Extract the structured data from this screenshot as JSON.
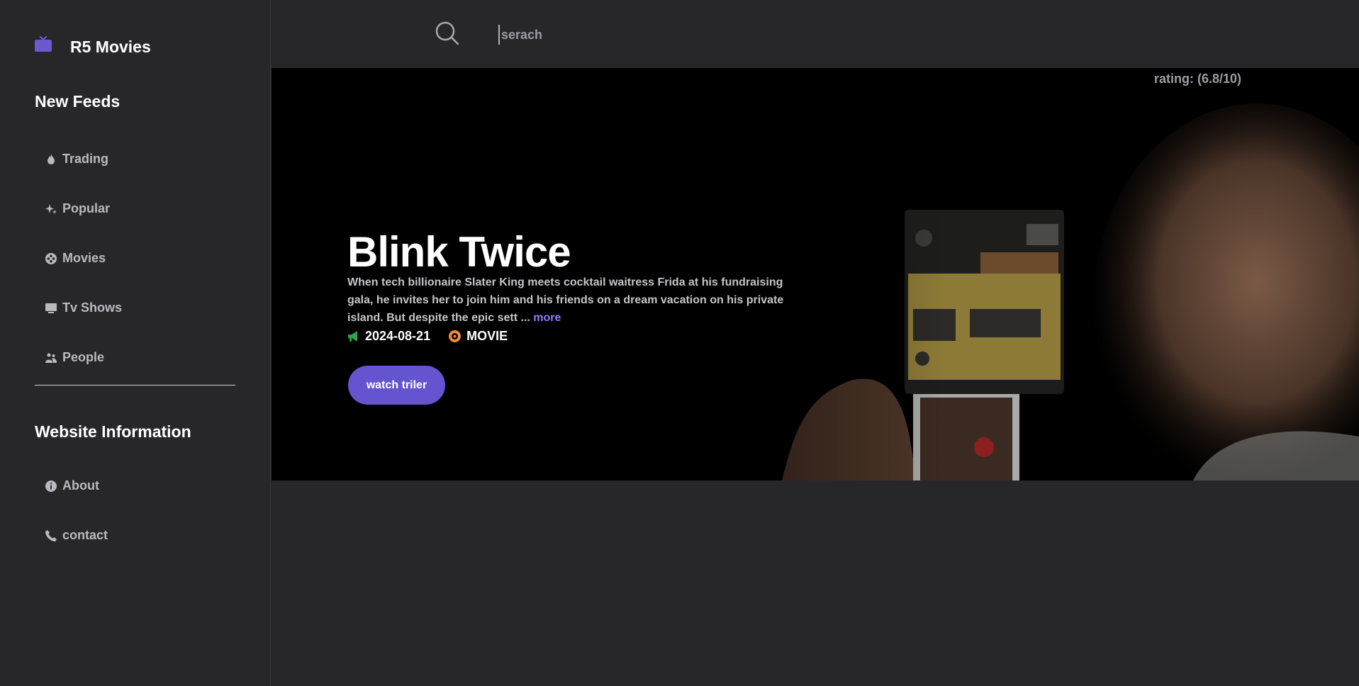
{
  "brand": {
    "name": "R5 Movies",
    "icon": "tv-icon",
    "icon_color": "#6a5acd"
  },
  "sidebar": {
    "feeds_title": "New Feeds",
    "feeds": [
      {
        "label": "Trading",
        "icon": "flame-icon"
      },
      {
        "label": "Popular",
        "icon": "sparkle-icon"
      },
      {
        "label": "Movies",
        "icon": "film-reel-icon"
      },
      {
        "label": "Tv Shows",
        "icon": "tv-icon"
      },
      {
        "label": "People",
        "icon": "people-icon"
      }
    ],
    "info_title": "Website Information",
    "info": [
      {
        "label": "About",
        "icon": "info-icon"
      },
      {
        "label": "contact",
        "icon": "phone-icon"
      }
    ]
  },
  "search": {
    "placeholder": "serach",
    "value": "",
    "icon": "search-icon"
  },
  "hero": {
    "rating": "rating: (6.8/10)",
    "title": "Blink Twice",
    "description": "When tech billionaire Slater King meets cocktail waitress Frida at his fundraising gala, he invites her to join him and his friends on a dream vacation on his private island. But despite the epic sett ...",
    "more_label": "more",
    "date": "2024-08-21",
    "date_icon": "megaphone-icon",
    "date_icon_color": "#2e9e4f",
    "media_type": "MOVIE",
    "media_icon": "circle-dot-icon",
    "media_icon_color": "#f08a3c",
    "trailer_label": "watch triler",
    "accent": "#6454d0"
  }
}
